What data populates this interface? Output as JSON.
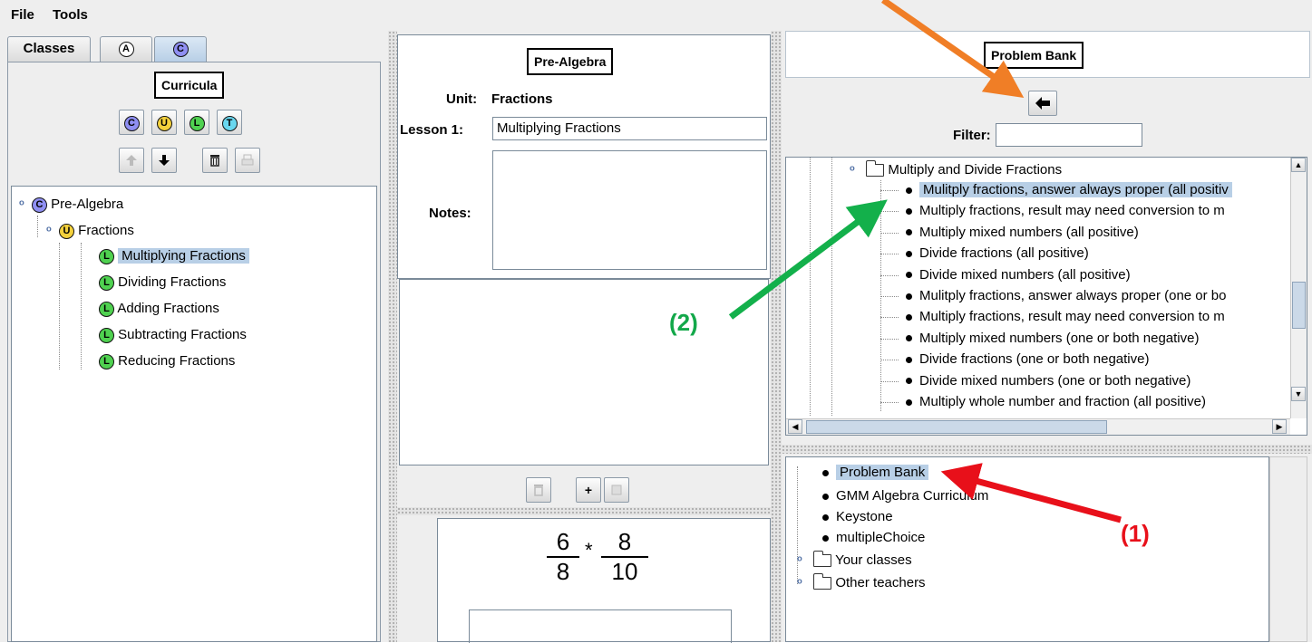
{
  "menu": [
    "File",
    "Tools"
  ],
  "tabs": {
    "classes": "Classes",
    "a": "A",
    "c": "C"
  },
  "left": {
    "title": "Curricula",
    "type_buttons": [
      "C",
      "U",
      "L",
      "T"
    ],
    "tree": {
      "root": {
        "badge": "C",
        "label": "Pre-Algebra"
      },
      "unit": {
        "badge": "U",
        "label": "Fractions"
      },
      "lessons": [
        {
          "badge": "L",
          "label": "Multiplying Fractions"
        },
        {
          "badge": "L",
          "label": "Dividing Fractions"
        },
        {
          "badge": "L",
          "label": "Adding Fractions"
        },
        {
          "badge": "L",
          "label": "Subtracting Fractions"
        },
        {
          "badge": "L",
          "label": "Reducing Fractions"
        }
      ]
    }
  },
  "middle": {
    "title": "Pre-Algebra",
    "unit_label": "Unit:",
    "unit_value": "Fractions",
    "lesson_label": "Lesson 1:",
    "lesson_value": "Multiplying Fractions",
    "notes_label": "Notes:",
    "plus_label": "+",
    "preview": {
      "n1": "6",
      "d1": "8",
      "op": "*",
      "n2": "8",
      "d2": "10"
    }
  },
  "right": {
    "title": "Problem Bank",
    "filter_label": "Filter:",
    "folder": "Multiply and Divide Fractions",
    "problems": [
      "Mulitply fractions, answer always proper (all positiv",
      "Multiply fractions, result may need conversion to m",
      "Multiply mixed numbers (all positive)",
      "Divide fractions (all positive)",
      "Divide mixed numbers (all positive)",
      "Mulitply fractions, answer always proper (one or bo",
      "Multiply fractions, result may need conversion to m",
      "Multiply mixed numbers (one or both negative)",
      "Divide fractions (one or both negative)",
      "Divide mixed numbers (one or both negative)",
      "Multiply whole number and fraction (all positive)"
    ],
    "sources": [
      "Problem Bank",
      "GMM Algebra Curriculum",
      "Keystone",
      "multipleChoice"
    ],
    "folders": [
      "Your classes",
      "Other teachers"
    ]
  },
  "annotations": {
    "one": "(1)",
    "two": "(2)"
  },
  "colors": {
    "selection": "#b8cfe6",
    "arrow_orange": "#f07e26",
    "arrow_green": "#13b04b",
    "arrow_red": "#e8101a",
    "anno_green": "#13a84a",
    "anno_red": "#e8101a"
  }
}
